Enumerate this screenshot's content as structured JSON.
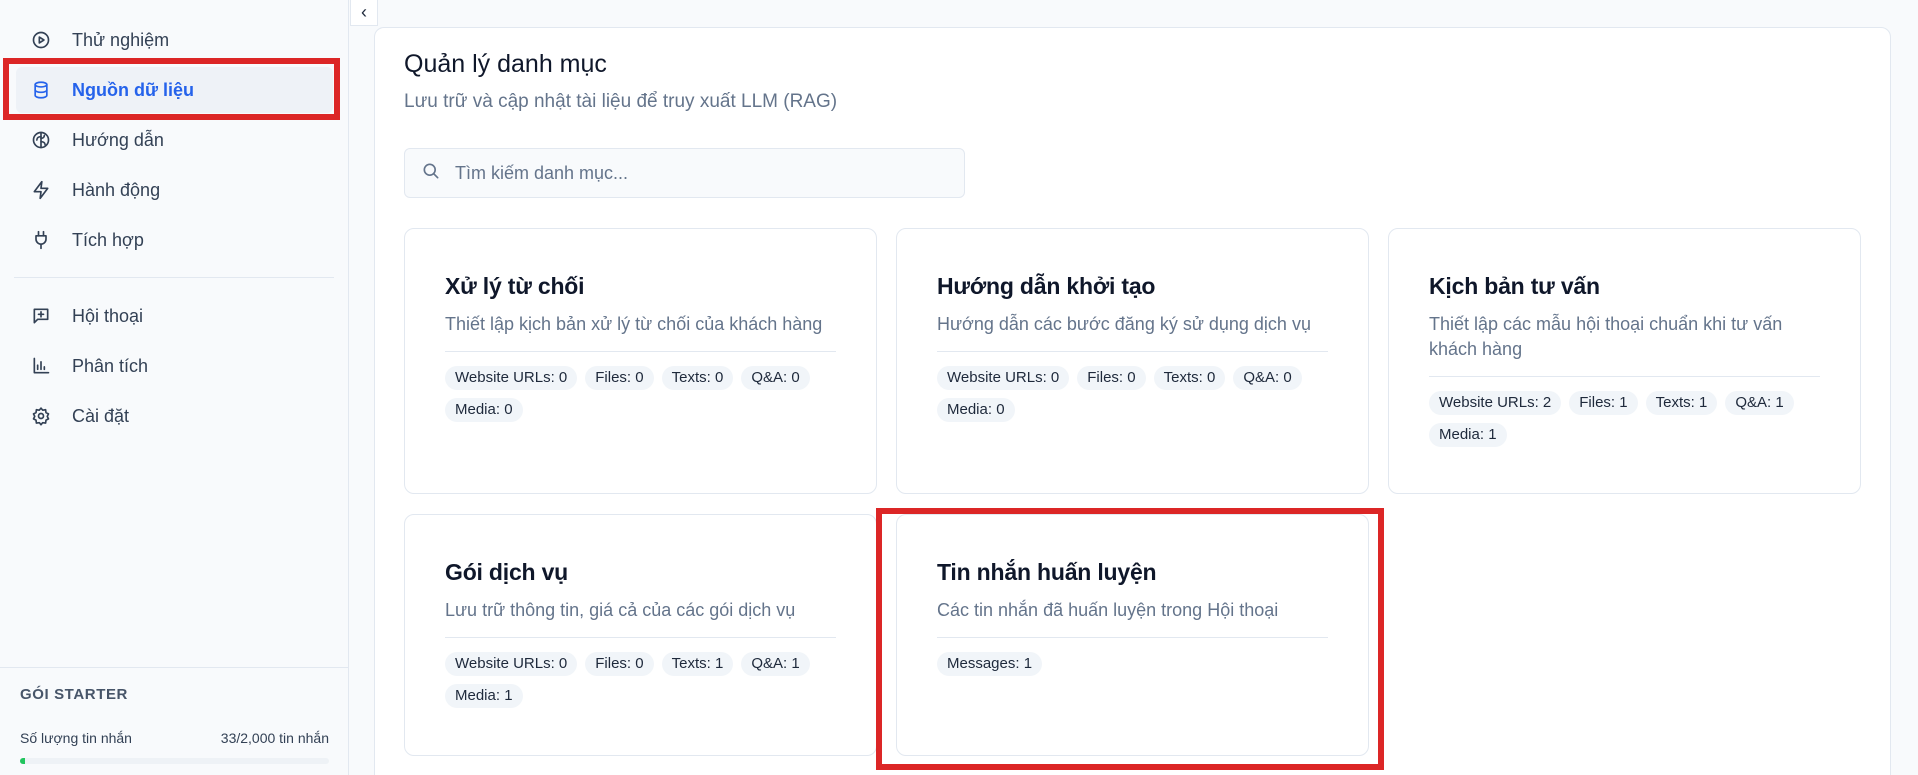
{
  "sidebar": {
    "items": [
      {
        "label": "Thử nghiệm",
        "icon": "play-circle-icon"
      },
      {
        "label": "Nguồn dữ liệu",
        "icon": "database-icon"
      },
      {
        "label": "Hướng dẫn",
        "icon": "brain-icon"
      },
      {
        "label": "Hành động",
        "icon": "lightning-icon"
      },
      {
        "label": "Tích hợp",
        "icon": "plug-icon"
      },
      {
        "label": "Hội thoại",
        "icon": "message-plus-icon"
      },
      {
        "label": "Phân tích",
        "icon": "bar-chart-icon"
      },
      {
        "label": "Cài đặt",
        "icon": "gear-icon"
      }
    ],
    "plan": {
      "title": "GÓI STARTER",
      "usage_label": "Số lượng tin nhắn",
      "usage_count": "33/2,000 tin nhắn",
      "usage_fraction": 0.0165
    }
  },
  "main": {
    "title": "Quản lý danh mục",
    "subtitle": "Lưu trữ và cập nhật tài liệu để truy xuất LLM (RAG)",
    "search_placeholder": "Tìm kiếm danh mục..."
  },
  "cards": [
    {
      "title": "Xử lý từ chối",
      "desc": "Thiết lập kịch bản xử lý từ chối của khách hàng",
      "badges": [
        "Website URLs: 0",
        "Files: 0",
        "Texts: 0",
        "Q&A: 0",
        "Media: 0"
      ]
    },
    {
      "title": "Hướng dẫn khởi tạo",
      "desc": "Hướng dẫn các bước đăng ký sử dụng dịch vụ",
      "badges": [
        "Website URLs: 0",
        "Files: 0",
        "Texts: 0",
        "Q&A: 0",
        "Media: 0"
      ]
    },
    {
      "title": "Kịch bản tư vấn",
      "desc": "Thiết lập các mẫu hội thoại chuẩn khi tư vấn khách hàng",
      "badges": [
        "Website URLs: 2",
        "Files: 1",
        "Texts: 1",
        "Q&A: 1",
        "Media: 1"
      ]
    },
    {
      "title": "Gói dịch vụ",
      "desc": "Lưu trữ thông tin, giá cả của các gói dịch vụ",
      "badges": [
        "Website URLs: 0",
        "Files: 0",
        "Texts: 1",
        "Q&A: 1",
        "Media: 1"
      ]
    },
    {
      "title": "Tin nhắn huấn luyện",
      "desc": "Các tin nhắn đã huấn luyện trong Hội thoại",
      "badges": [
        "Messages: 1"
      ]
    }
  ],
  "colors": {
    "accent": "#2563eb",
    "highlight": "#dc2626",
    "progress": "#22c55e"
  }
}
